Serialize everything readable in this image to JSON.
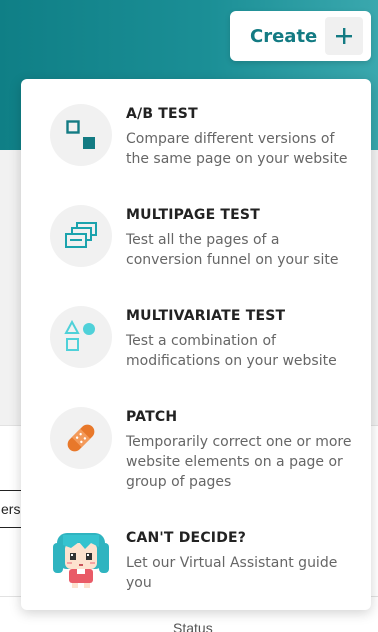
{
  "background": {
    "filter_label": "ers",
    "status_label": "Status"
  },
  "create_button": {
    "label": "Create",
    "icon": "plus-icon"
  },
  "menu": {
    "items": [
      {
        "title": "A/B TEST",
        "description": "Compare different versions of the same page on your website",
        "icon": "ab-test-icon"
      },
      {
        "title": "MULTIPAGE TEST",
        "description": "Test all the pages of a conversion funnel on your site",
        "icon": "multipage-icon"
      },
      {
        "title": "MULTIVARIATE TEST",
        "description": "Test a combination of modifications on your website",
        "icon": "multivariate-icon"
      },
      {
        "title": "PATCH",
        "description": "Temporarily correct one or more website elements on a page or group of pages",
        "icon": "bandage-icon"
      },
      {
        "title": "CAN'T DECIDE?",
        "description": "Let our Virtual Assistant guide you",
        "icon": "assistant-avatar"
      }
    ]
  },
  "colors": {
    "brand": "#137b83",
    "icon_teal": "#1ba3ad",
    "icon_cyan": "#4fd1d9",
    "patch_orange": "#e8782a"
  }
}
